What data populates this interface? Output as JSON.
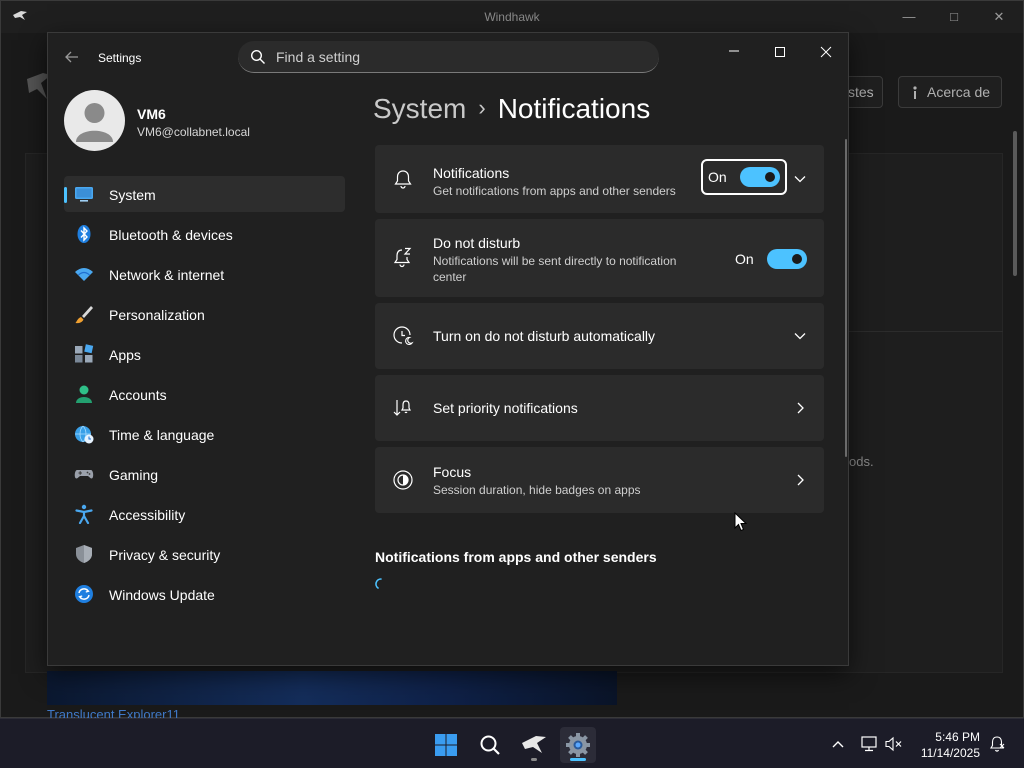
{
  "background_window": {
    "title": "Windhawk",
    "button_partial": "stes",
    "about_button": "Acerca de",
    "partial_text": "ods.",
    "thumbnail_link": "Translucent Explorer11"
  },
  "settings": {
    "app_title": "Settings",
    "search": {
      "placeholder": "Find a setting"
    },
    "user": {
      "name": "VM6",
      "email": "VM6@collabnet.local"
    },
    "nav": [
      {
        "label": "System",
        "icon": "system-icon",
        "active": true
      },
      {
        "label": "Bluetooth & devices",
        "icon": "bluetooth-icon"
      },
      {
        "label": "Network & internet",
        "icon": "wifi-icon"
      },
      {
        "label": "Personalization",
        "icon": "brush-icon"
      },
      {
        "label": "Apps",
        "icon": "apps-icon"
      },
      {
        "label": "Accounts",
        "icon": "person-icon"
      },
      {
        "label": "Time & language",
        "icon": "globe-clock-icon"
      },
      {
        "label": "Gaming",
        "icon": "gamepad-icon"
      },
      {
        "label": "Accessibility",
        "icon": "accessibility-icon"
      },
      {
        "label": "Privacy & security",
        "icon": "shield-icon"
      },
      {
        "label": "Windows Update",
        "icon": "update-icon"
      }
    ],
    "breadcrumb": {
      "parent": "System",
      "separator": "›",
      "current": "Notifications"
    },
    "cards": {
      "notifications": {
        "title": "Notifications",
        "desc": "Get notifications from apps and other senders",
        "toggle_state": "On"
      },
      "dnd": {
        "title": "Do not disturb",
        "desc": "Notifications will be sent directly to notification center",
        "toggle_state": "On"
      },
      "auto_dnd": {
        "title": "Turn on do not disturb automatically"
      },
      "priority": {
        "title": "Set priority notifications"
      },
      "focus": {
        "title": "Focus",
        "desc": "Session duration, hide badges on apps"
      }
    },
    "section_header": "Notifications from apps and other senders"
  },
  "taskbar": {
    "time": "5:46 PM",
    "date": "11/14/2025",
    "apps": [
      "start-icon",
      "search-icon",
      "windhawk-icon",
      "settings-icon"
    ]
  },
  "colors": {
    "accent": "#4cc2ff",
    "card": "#2b2b2b",
    "window": "#202020"
  }
}
